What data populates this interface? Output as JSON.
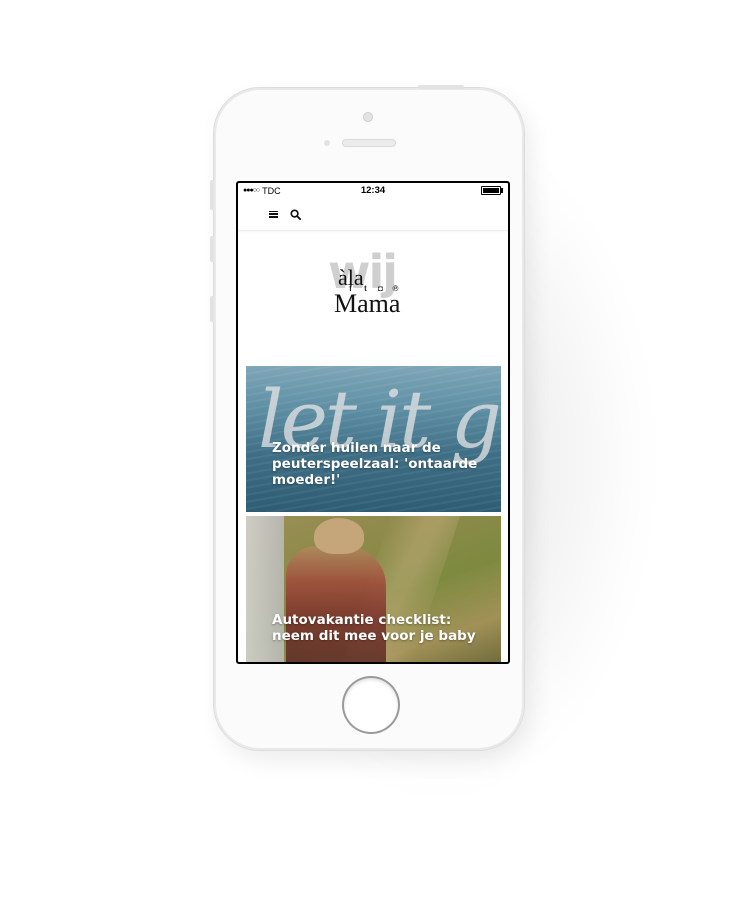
{
  "status_bar": {
    "carrier": "TDC",
    "signal_dots": "●●●○○",
    "time": "12:34"
  },
  "navbar": {
    "menu_icon": "hamburger-icon",
    "search_icon": "search-icon"
  },
  "logo": {
    "overlay_word": "wij",
    "line1": "àla",
    "line2": "Mama"
  },
  "social": {
    "facebook": "f",
    "twitter": "t",
    "instagram": "◘",
    "pinterest": "℗"
  },
  "articles": [
    {
      "image_text": "let it go.",
      "title": "Zonder huilen naar de peuterspeelzaal: 'ontaarde moeder!'"
    },
    {
      "title": "Autovakantie checklist: neem dit mee voor je baby"
    }
  ]
}
